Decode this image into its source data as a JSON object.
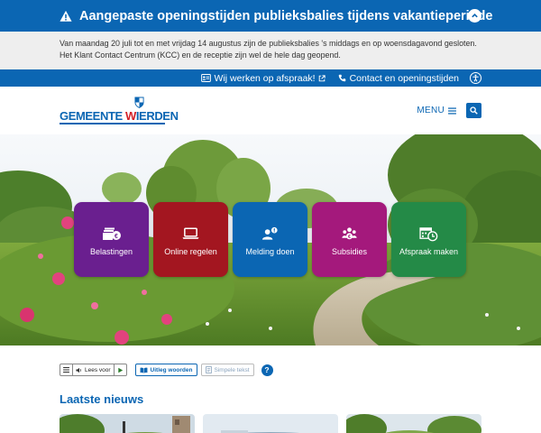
{
  "alert": {
    "title": "Aangepaste openingstijden publieksbalies tijdens vakantieperiode",
    "line1": "Van maandag 20 juli tot en met vrijdag 14 augustus zijn de publieksbalies 's middags en op woensdagavond gesloten.",
    "line2": "Het Klant Contact Centrum (KCC) en de receptie zijn wel de hele dag geopend.",
    "icon": "warning-icon",
    "collapse_icon": "chevron-up-icon"
  },
  "utility": {
    "afspraak_label": "Wij werken op afspraak!",
    "contact_label": "Contact en openingstijden",
    "accessibility_icon": "accessibility-icon"
  },
  "header": {
    "logo_part1": "GEMEENTE ",
    "logo_w": "W",
    "logo_part2": "IERDEN",
    "menu_label": "MENU",
    "search_icon": "search-icon"
  },
  "tiles": [
    {
      "label": "Belastingen",
      "icon": "money-icon",
      "color": "#6a1f8f"
    },
    {
      "label": "Online regelen",
      "icon": "laptop-icon",
      "color": "#a31620"
    },
    {
      "label": "Melding doen",
      "icon": "person-alert-icon",
      "color": "#0b66b3"
    },
    {
      "label": "Subsidies",
      "icon": "group-money-icon",
      "color": "#a4197c"
    },
    {
      "label": "Afspraak maken",
      "icon": "calendar-clock-icon",
      "color": "#248a47"
    }
  ],
  "readbar": {
    "lees_voor": "Lees voor",
    "uitleg": "Uitleg woorden",
    "simpel": "Simpele tekst",
    "help": "?"
  },
  "news": {
    "title": "Laatste nieuws"
  },
  "colors": {
    "brand_blue": "#0b66b3",
    "brand_red": "#d32027",
    "alert_bg": "#eeeeee"
  }
}
